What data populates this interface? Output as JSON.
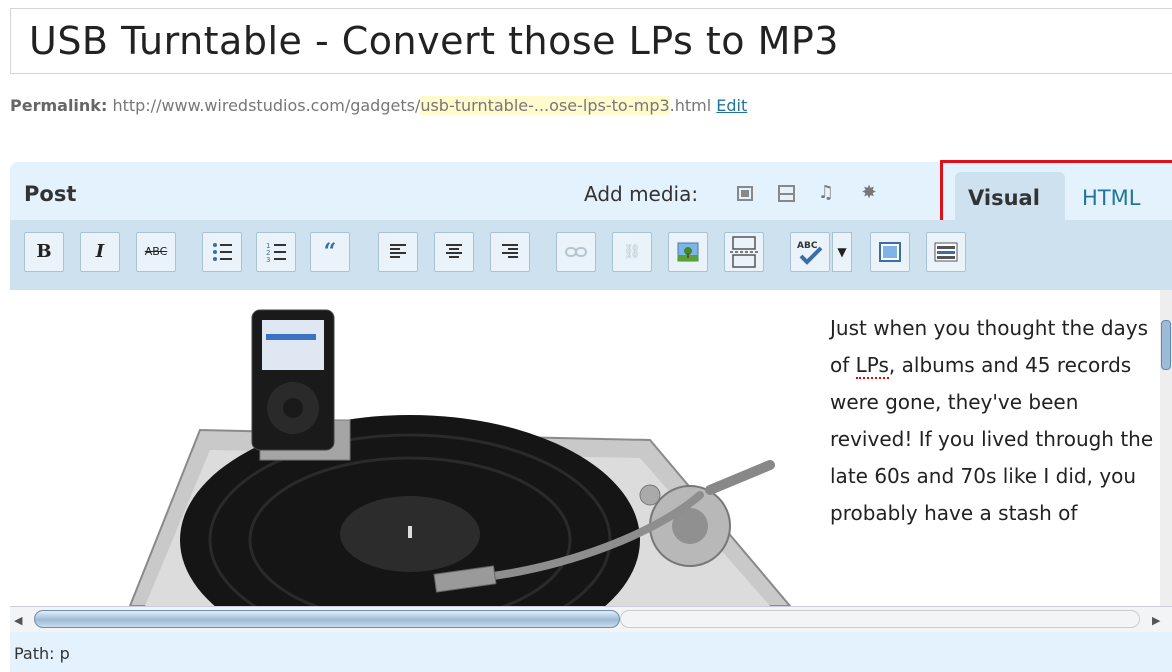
{
  "post": {
    "title": "USB Turntable - Convert those LPs to MP3"
  },
  "permalink": {
    "label": "Permalink:",
    "base": "http://www.wiredstudios.com/gadgets/",
    "slug": "usb-turntable-...ose-lps-to-mp3",
    "suffix": ".html",
    "edit_label": "Edit"
  },
  "editor": {
    "heading": "Post",
    "add_media_label": "Add media:",
    "media_icons": [
      "image-icon",
      "gallery-icon",
      "audio-icon",
      "other-media-icon"
    ],
    "tabs": {
      "visual": "Visual",
      "html": "HTML"
    },
    "active_tab": "Visual",
    "highlight_color": "#e0101b"
  },
  "toolbar": {
    "buttons": [
      {
        "name": "bold-button",
        "glyph": "B"
      },
      {
        "name": "italic-button",
        "glyph": "I"
      },
      {
        "name": "strikethrough-button",
        "glyph": "ABC"
      },
      {
        "name": "bullet-list-button",
        "glyph": "☰"
      },
      {
        "name": "numbered-list-button",
        "glyph": "☰"
      },
      {
        "name": "blockquote-button",
        "glyph": "66"
      },
      {
        "name": "align-left-button",
        "glyph": "≡"
      },
      {
        "name": "align-center-button",
        "glyph": "≡"
      },
      {
        "name": "align-right-button",
        "glyph": "≡"
      },
      {
        "name": "insert-link-button",
        "glyph": "link"
      },
      {
        "name": "unlink-button",
        "glyph": "unlink"
      },
      {
        "name": "insert-image-button",
        "glyph": "image"
      },
      {
        "name": "insert-more-tag-button",
        "glyph": "more"
      },
      {
        "name": "spellcheck-button",
        "glyph": "ABC"
      },
      {
        "name": "spellcheck-dropdown",
        "glyph": "▾"
      },
      {
        "name": "fullscreen-button",
        "glyph": "fullscreen"
      },
      {
        "name": "kitchen-sink-button",
        "glyph": "kitchen-sink"
      }
    ]
  },
  "content": {
    "text_before": "Just when you thought the days of ",
    "text_misspelled": "LPs",
    "text_after": ", albums and 45 records were gone, they've been revived! If you lived through the late 60s and 70s like I did, you probably have a stash of"
  },
  "statusbar": {
    "path": "Path: p"
  }
}
